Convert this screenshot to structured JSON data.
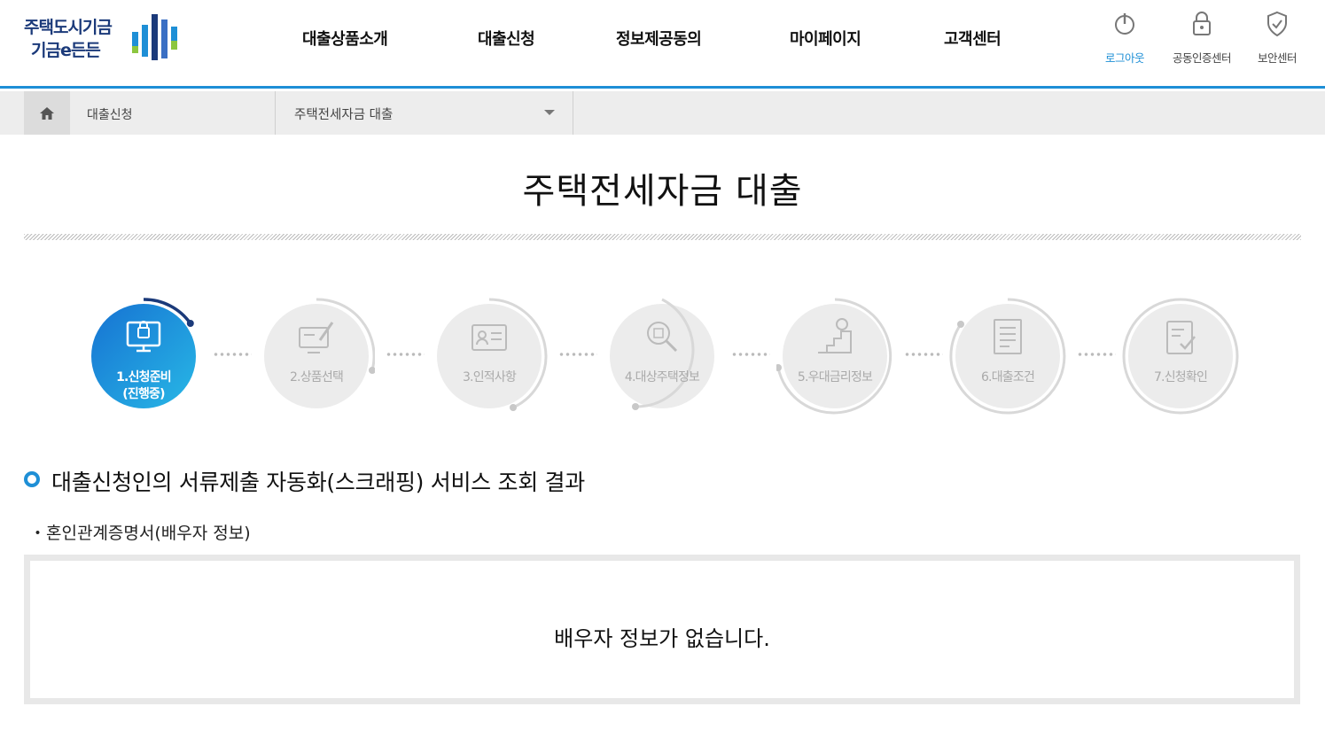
{
  "logo": {
    "line1": "주택도시기금",
    "line2": "기금e든든"
  },
  "gnb": [
    "대출상품소개",
    "대출신청",
    "정보제공동의",
    "마이페이지",
    "고객센터"
  ],
  "util": [
    {
      "label": "로그아웃",
      "icon": "power-icon",
      "active": true
    },
    {
      "label": "공동인증센터",
      "icon": "lock-icon"
    },
    {
      "label": "보안센터",
      "icon": "shield-icon"
    }
  ],
  "breadcrumb": {
    "level1": "대출신청",
    "level2": "주택전세자금 대출"
  },
  "page_title": "주택전세자금 대출",
  "steps": [
    {
      "label": "1.신청준비",
      "sub": "(진행중)",
      "icon": "monitor-icon",
      "active": true
    },
    {
      "label": "2.상품선택",
      "icon": "computer-pen-icon"
    },
    {
      "label": "3.인적사항",
      "icon": "id-card-icon"
    },
    {
      "label": "4.대상주택정보",
      "icon": "magnifier-icon"
    },
    {
      "label": "5.우대금리정보",
      "icon": "stairs-coin-icon"
    },
    {
      "label": "6.대출조건",
      "icon": "document-icon"
    },
    {
      "label": "7.신청확인",
      "icon": "checklist-icon"
    }
  ],
  "section": {
    "title": "대출신청인의 서류제출 자동화(스크래핑) 서비스 조회 결과",
    "sub_item": "・혼인관계증명서(배우자 정보)",
    "empty_message": "배우자 정보가 없습니다."
  },
  "colors": {
    "accent": "#1e8fd6",
    "brand_navy": "#1b3a7a"
  }
}
